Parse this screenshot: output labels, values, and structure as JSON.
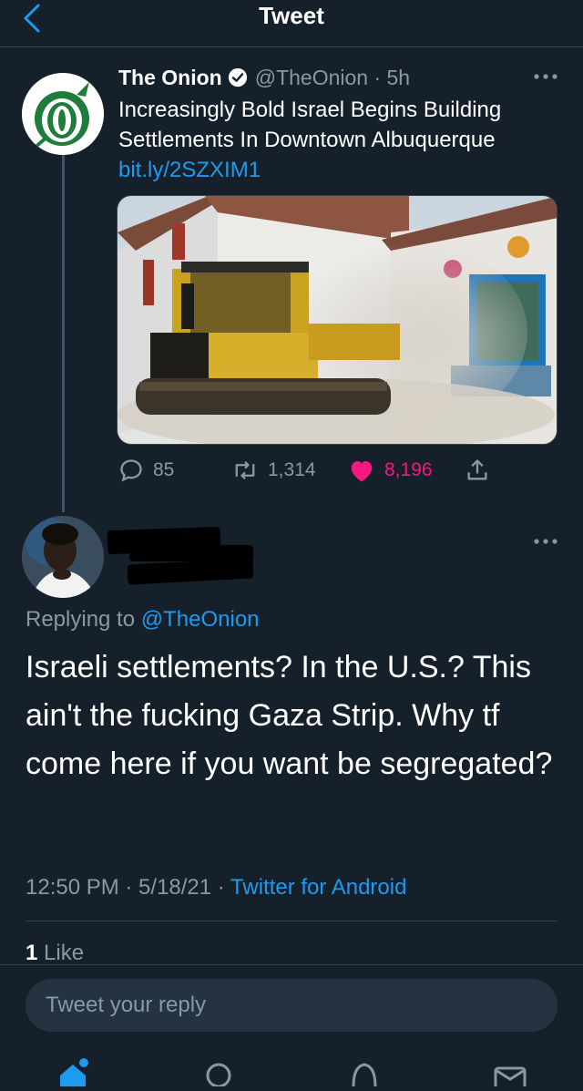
{
  "header": {
    "title": "Tweet"
  },
  "quoted_tweet": {
    "author_name": "The Onion",
    "handle": "@TheOnion",
    "age": "· 5h",
    "text": "Increasingly Bold Israel Begins Building Settlements In Downtown Albuquerque",
    "link": "bit.ly/2SZXIM1",
    "stats": {
      "replies": "85",
      "retweets": "1,314",
      "likes": "8,196"
    },
    "colors": {
      "like": "#f91880",
      "link": "#1d9bf0"
    }
  },
  "reply_tweet": {
    "replying_prefix": "Replying to",
    "replying_handle": "@TheOnion",
    "text": "Israeli settlements? In the U.S.? This ain't the fucking Gaza Strip. Why tf come here if you want be segregated?",
    "timestamp": "12:50 PM · 5/18/21 ·",
    "source": "Twitter for Android",
    "like_count": "1",
    "like_label": "Like"
  },
  "composer": {
    "placeholder": "Tweet your reply"
  },
  "bottom_nav": {
    "items": [
      "home-icon",
      "search-icon",
      "notifications-icon",
      "messages-icon"
    ]
  }
}
